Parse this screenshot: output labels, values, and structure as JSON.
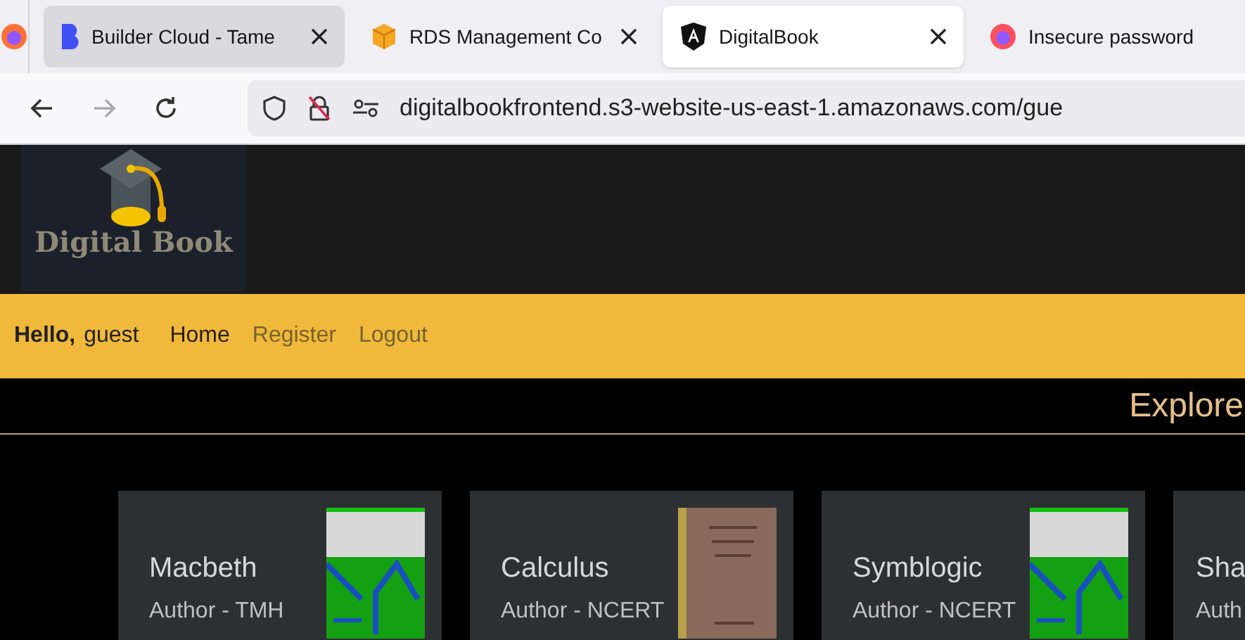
{
  "browser": {
    "tabs": [
      {
        "title": "Builder Cloud - Tame",
        "selected": false,
        "closable": true,
        "kind": "builder"
      },
      {
        "title": "RDS Management Co",
        "selected": false,
        "closable": true,
        "kind": "box"
      },
      {
        "title": "DigitalBook",
        "selected": true,
        "closable": true,
        "kind": "angular"
      },
      {
        "title": "Insecure password",
        "selected": false,
        "closable": false,
        "kind": "firefox"
      }
    ],
    "url": "digitalbookfrontend.s3-website-us-east-1.amazonaws.com/gue"
  },
  "logo": {
    "text": "Digital Book"
  },
  "nav": {
    "greeting": "Hello,",
    "user": "guest",
    "links": [
      {
        "label": "Home",
        "selected": true
      },
      {
        "label": "Register",
        "selected": false
      },
      {
        "label": "Logout",
        "selected": false
      }
    ]
  },
  "heading": "Explore",
  "books": [
    {
      "title": "Macbeth",
      "author": "Author - TMH",
      "kind": "green_cover"
    },
    {
      "title": "Calculus",
      "author": "Author - NCERT",
      "kind": "brown_cover"
    },
    {
      "title": "Symblogic",
      "author": "Author - NCERT",
      "kind": "green_cover"
    },
    {
      "title": "Sha",
      "author": "Auth",
      "kind": "partial"
    }
  ]
}
